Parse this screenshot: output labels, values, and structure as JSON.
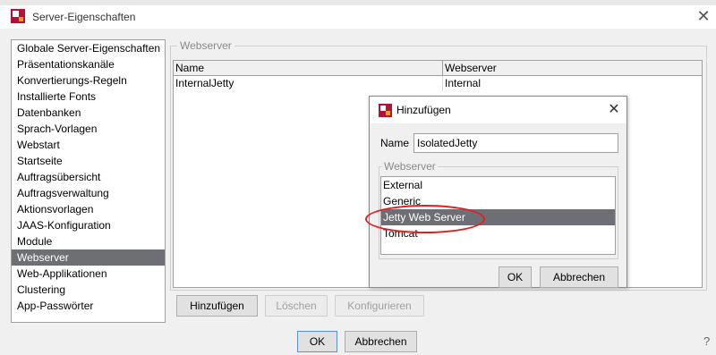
{
  "window": {
    "title": "Server-Eigenschaften",
    "close_glyph": "✕"
  },
  "sidebar": {
    "items": [
      "Globale Server-Eigenschaften",
      "Präsentationskanäle",
      "Konvertierungs-Regeln",
      "Installierte Fonts",
      "Datenbanken",
      "Sprach-Vorlagen",
      "Webstart",
      "Startseite",
      "Auftragsübersicht",
      "Auftragsverwaltung",
      "Aktionsvorlagen",
      "JAAS-Konfiguration",
      "Module",
      "Webserver",
      "Web-Applikationen",
      "Clustering",
      "App-Passwörter"
    ],
    "selected_index": 13
  },
  "main": {
    "group_title": "Webserver",
    "table": {
      "columns": [
        "Name",
        "Webserver"
      ],
      "rows": [
        [
          "InternalJetty",
          "Internal"
        ]
      ]
    },
    "buttons": {
      "add": "Hinzufügen",
      "delete": "Löschen",
      "configure": "Konfigurieren"
    }
  },
  "footer": {
    "ok": "OK",
    "cancel": "Abbrechen",
    "help": "?"
  },
  "dialog": {
    "title": "Hinzufügen",
    "close_glyph": "✕",
    "name_label": "Name",
    "name_value": "IsolatedJetty",
    "group_title": "Webserver",
    "options": [
      "External",
      "Generic",
      "Jetty Web Server",
      "Tomcat"
    ],
    "selected_index": 2,
    "ok": "OK",
    "cancel": "Abbrechen"
  },
  "colors": {
    "selection": "#6d6f75",
    "highlight_ellipse": "#e02020",
    "app_icon": "#b5103a"
  }
}
